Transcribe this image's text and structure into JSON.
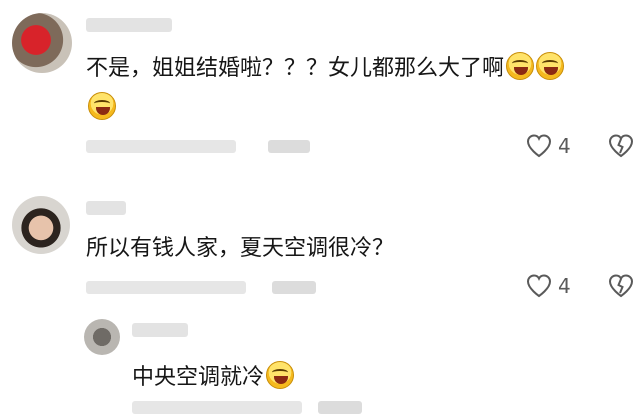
{
  "comments": [
    {
      "author": "",
      "text": "不是，姐姐结婚啦？？？女儿都那么大了啊",
      "meta": "",
      "reply_label": "",
      "like_count": "4"
    },
    {
      "author": "",
      "text": "所以有钱人家，夏天空调很冷？",
      "meta": "",
      "reply_label": "",
      "like_count": "4"
    }
  ],
  "replies": [
    {
      "author": "",
      "text": "中央空调就冷",
      "meta": "",
      "reply_label": ""
    }
  ],
  "icons": {
    "like": "heart-icon",
    "dislike": "broken-heart-icon",
    "emoji": "laughing-tears-emoji"
  },
  "colors": {
    "text": "#161616",
    "secondary": "#5a5a5a"
  }
}
